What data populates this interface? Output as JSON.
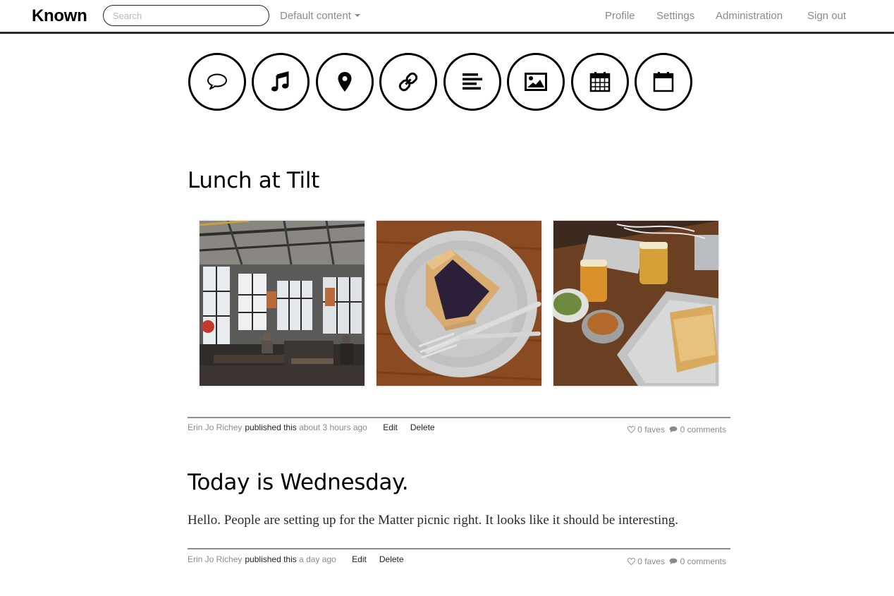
{
  "app": {
    "brand": "Known"
  },
  "nav": {
    "search_placeholder": "Search",
    "content_filter": "Default content",
    "links": [
      "Profile",
      "Settings",
      "Administration",
      "Sign out"
    ]
  },
  "post_types": [
    "status-update-icon",
    "music-icon",
    "location-pin-icon",
    "link-icon",
    "post-text-icon",
    "photo-icon",
    "event-icon",
    "rsvp-icon"
  ],
  "posts": [
    {
      "title": "Lunch at Tilt",
      "photos": [
        "restaurant-interior-photo",
        "blueberry-pie-photo",
        "lunch-table-photo"
      ],
      "meta": {
        "author": "Erin Jo Richey",
        "published": "published this",
        "time": "about 3 hours ago",
        "edit": "Edit",
        "delete": "Delete",
        "faves": "0 faves",
        "comments": "0 comments"
      }
    },
    {
      "title": "Today is Wednesday.",
      "body": "Hello. People are setting up for the Matter picnic right. It looks like it should be interesting.",
      "meta": {
        "author": "Erin Jo Richey",
        "published": "published this",
        "time": "a day ago",
        "edit": "Edit",
        "delete": "Delete",
        "faves": "0 faves",
        "comments": "0 comments"
      }
    }
  ]
}
